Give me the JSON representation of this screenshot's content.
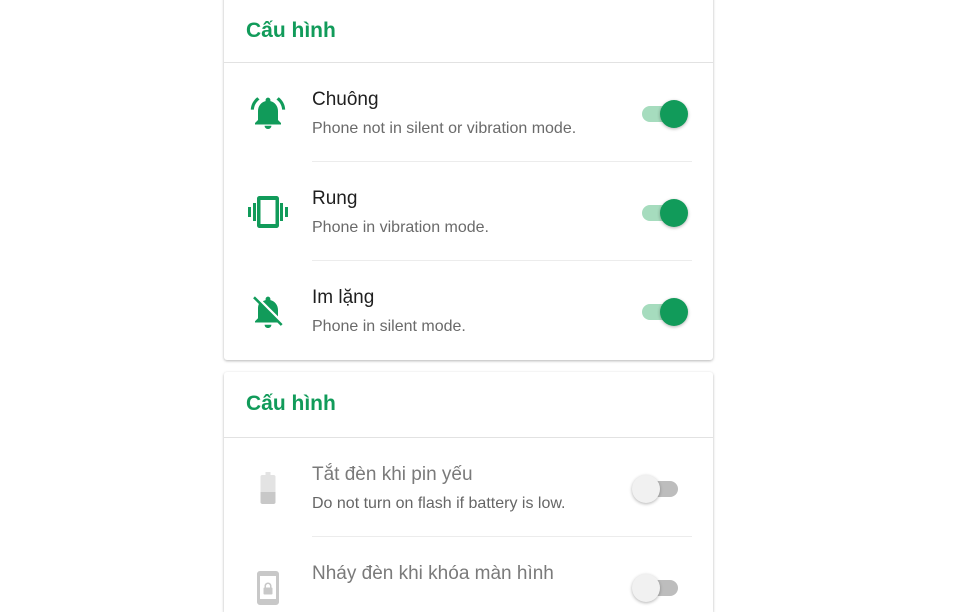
{
  "colors": {
    "accent": "#119b5a",
    "accent_light": "#a6dcbe",
    "disabled_icon": "#c8c8c8"
  },
  "section1": {
    "title": "Cấu hình",
    "items": [
      {
        "title": "Chuông",
        "subtitle": "Phone not in silent or vibration mode.",
        "icon": "bell-ring-icon",
        "enabled": true
      },
      {
        "title": "Rung",
        "subtitle": "Phone in vibration mode.",
        "icon": "vibrate-icon",
        "enabled": true
      },
      {
        "title": "Im lặng",
        "subtitle": "Phone in silent mode.",
        "icon": "bell-off-icon",
        "enabled": true
      }
    ]
  },
  "section2": {
    "title": "Cấu hình",
    "items": [
      {
        "title": "Tắt đèn khi pin yếu",
        "subtitle": "Do not turn on flash if battery is low.",
        "icon": "battery-low-icon",
        "enabled": false
      },
      {
        "title": "Nháy đèn khi khóa màn hình",
        "subtitle": "",
        "icon": "lock-screen-icon",
        "enabled": false
      }
    ]
  }
}
